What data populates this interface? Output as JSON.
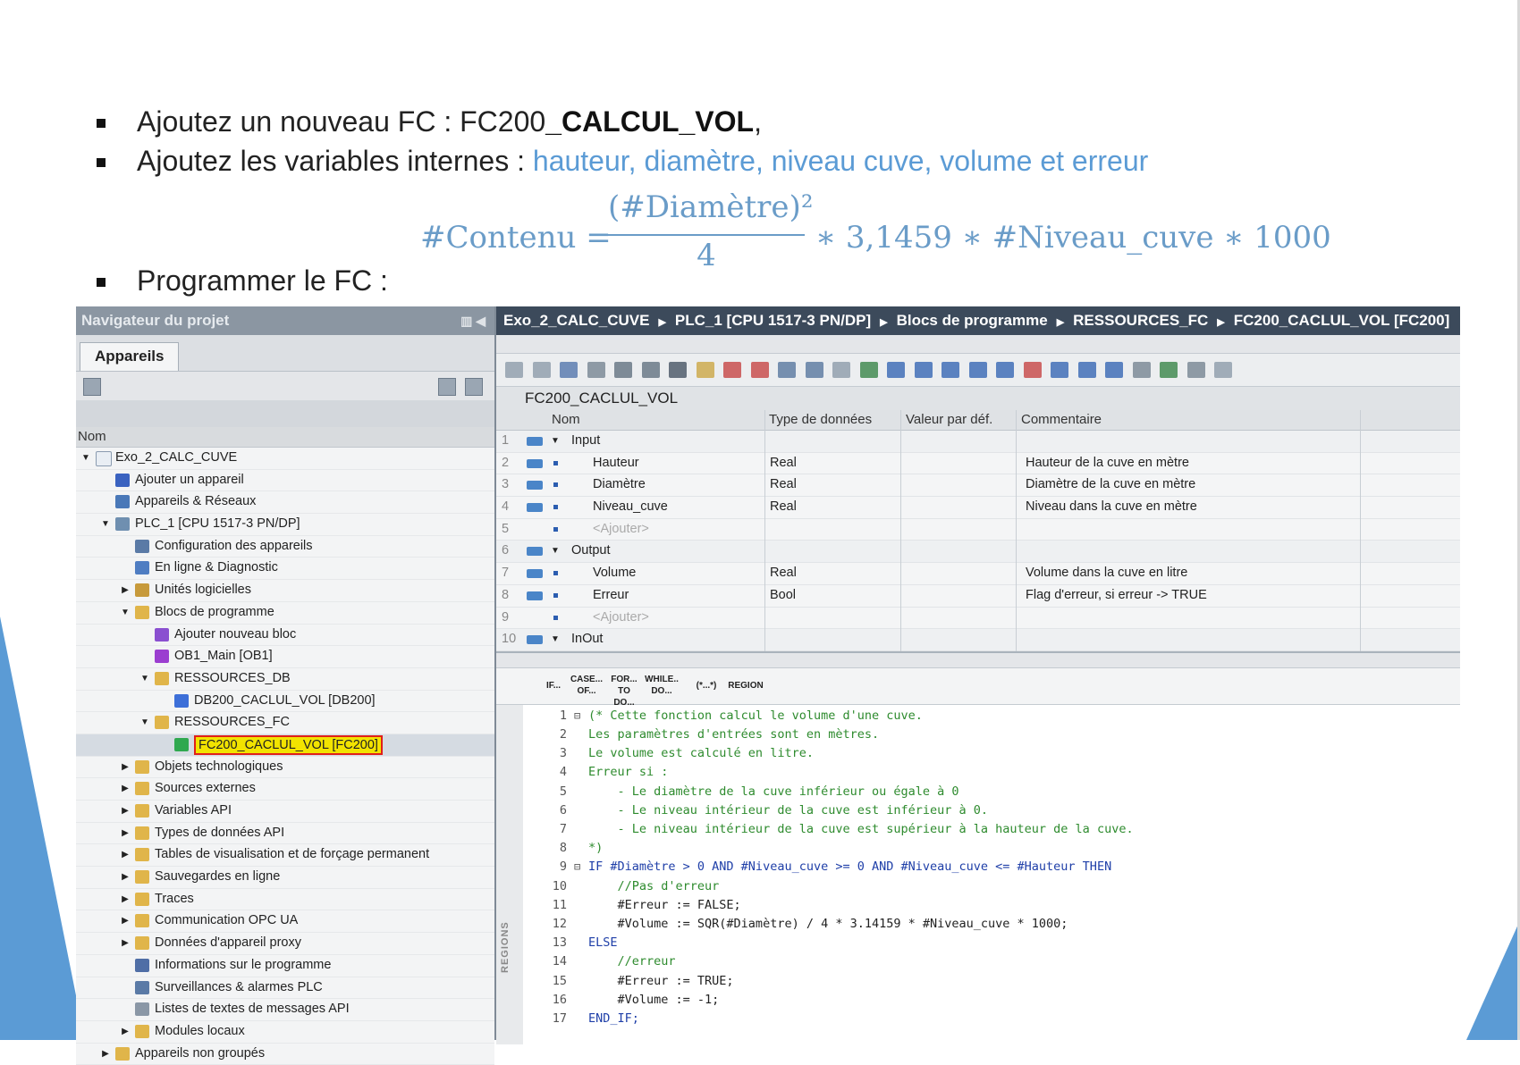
{
  "slide": {
    "bullet1_prefix": "Ajoutez un nouveau FC : FC200",
    "bullet1_bold": "_CALCUL_VOL",
    "bullet1_suffix": ",",
    "bullet2_prefix": "Ajoutez les variables internes : ",
    "bullet2_blue": "hauteur, diamètre, niveau cuve, volume et erreur",
    "bullet3": "Programmer le FC :",
    "formula": {
      "lhs": "#Contenu =",
      "numerator": "(#Diamètre)²",
      "denominator": "4",
      "rhs": "∗ 3,1459 ∗ #Niveau_cuve  ∗ 1000"
    }
  },
  "navigator": {
    "title": "Navigateur du projet",
    "tab": "Appareils",
    "column_header": "Nom",
    "tree": [
      {
        "label": "Exo_2_CALC_CUVE",
        "level": 0,
        "arrow": "open",
        "icon": "project-icon"
      },
      {
        "label": "Ajouter un appareil",
        "level": 1,
        "arrow": "none",
        "icon": "add-device-icon"
      },
      {
        "label": "Appareils & Réseaux",
        "level": 1,
        "arrow": "none",
        "icon": "network-icon"
      },
      {
        "label": "PLC_1 [CPU 1517-3 PN/DP]",
        "level": 1,
        "arrow": "open",
        "icon": "plc-icon"
      },
      {
        "label": "Configuration des appareils",
        "level": 2,
        "arrow": "none",
        "icon": "device-config-icon"
      },
      {
        "label": "En ligne & Diagnostic",
        "level": 2,
        "arrow": "none",
        "icon": "diagnostic-icon"
      },
      {
        "label": "Unités logicielles",
        "level": 2,
        "arrow": "closed",
        "icon": "software-units-icon"
      },
      {
        "label": "Blocs de programme",
        "level": 2,
        "arrow": "open",
        "icon": "folder-icon"
      },
      {
        "label": "Ajouter nouveau bloc",
        "level": 3,
        "arrow": "none",
        "icon": "add-block-icon"
      },
      {
        "label": "OB1_Main [OB1]",
        "level": 3,
        "arrow": "none",
        "icon": "ob-block-icon"
      },
      {
        "label": "RESSOURCES_DB",
        "level": 3,
        "arrow": "open",
        "icon": "folder-icon"
      },
      {
        "label": "DB200_CACLUL_VOL [DB200]",
        "level": 4,
        "arrow": "none",
        "icon": "db-block-icon"
      },
      {
        "label": "RESSOURCES_FC",
        "level": 3,
        "arrow": "open",
        "icon": "folder-icon"
      },
      {
        "label": "FC200_CACLUL_VOL [FC200]",
        "level": 4,
        "arrow": "none",
        "icon": "fc-block-icon",
        "selected": true
      },
      {
        "label": "Objets technologiques",
        "level": 2,
        "arrow": "closed",
        "icon": "folder-icon"
      },
      {
        "label": "Sources externes",
        "level": 2,
        "arrow": "closed",
        "icon": "folder-icon"
      },
      {
        "label": "Variables API",
        "level": 2,
        "arrow": "closed",
        "icon": "folder-icon"
      },
      {
        "label": "Types de données API",
        "level": 2,
        "arrow": "closed",
        "icon": "folder-icon"
      },
      {
        "label": "Tables de visualisation et de forçage permanent",
        "level": 2,
        "arrow": "closed",
        "icon": "folder-icon"
      },
      {
        "label": "Sauvegardes en ligne",
        "level": 2,
        "arrow": "closed",
        "icon": "folder-icon"
      },
      {
        "label": "Traces",
        "level": 2,
        "arrow": "closed",
        "icon": "folder-icon"
      },
      {
        "label": "Communication OPC UA",
        "level": 2,
        "arrow": "closed",
        "icon": "folder-icon"
      },
      {
        "label": "Données d'appareil proxy",
        "level": 2,
        "arrow": "closed",
        "icon": "folder-icon"
      },
      {
        "label": "Informations sur le programme",
        "level": 2,
        "arrow": "none",
        "icon": "info-icon"
      },
      {
        "label": "Surveillances & alarmes PLC",
        "level": 2,
        "arrow": "none",
        "icon": "alarm-icon"
      },
      {
        "label": "Listes de textes de messages API",
        "level": 2,
        "arrow": "none",
        "icon": "text-list-icon"
      },
      {
        "label": "Modules locaux",
        "level": 2,
        "arrow": "closed",
        "icon": "folder-icon"
      },
      {
        "label": "Appareils non groupés",
        "level": 1,
        "arrow": "closed",
        "icon": "folder-icon"
      }
    ]
  },
  "editor": {
    "breadcrumb": [
      "Exo_2_CALC_CUVE",
      "PLC_1 [CPU 1517-3 PN/DP]",
      "Blocs de programme",
      "RESSOURCES_FC",
      "FC200_CACLUL_VOL [FC200]"
    ],
    "block_name": "FC200_CACLUL_VOL",
    "interface_headers": {
      "nom": "Nom",
      "type": "Type de données",
      "default": "Valeur par déf.",
      "comment": "Commentaire"
    },
    "interface_rows": [
      {
        "num": "1",
        "kind": "section",
        "name": "Input",
        "type": "",
        "comment": ""
      },
      {
        "num": "2",
        "kind": "var",
        "name": "Hauteur",
        "type": "Real",
        "comment": "Hauteur de la cuve en mètre"
      },
      {
        "num": "3",
        "kind": "var",
        "name": "Diamètre",
        "type": "Real",
        "comment": "Diamètre de la cuve en mètre"
      },
      {
        "num": "4",
        "kind": "var",
        "name": "Niveau_cuve",
        "type": "Real",
        "comment": "Niveau dans la cuve en mètre"
      },
      {
        "num": "5",
        "kind": "add",
        "name": "<Ajouter>",
        "type": "",
        "comment": ""
      },
      {
        "num": "6",
        "kind": "section",
        "name": "Output",
        "type": "",
        "comment": ""
      },
      {
        "num": "7",
        "kind": "var",
        "name": "Volume",
        "type": "Real",
        "comment": "Volume dans la cuve en litre"
      },
      {
        "num": "8",
        "kind": "var",
        "name": "Erreur",
        "type": "Bool",
        "comment": "Flag d'erreur, si erreur -> TRUE"
      },
      {
        "num": "9",
        "kind": "add",
        "name": "<Ajouter>",
        "type": "",
        "comment": ""
      },
      {
        "num": "10",
        "kind": "section",
        "name": "InOut",
        "type": "",
        "comment": ""
      }
    ],
    "code_templates": [
      "IF...",
      "CASE... OF...",
      "FOR... TO DO...",
      "WHILE.. DO...",
      "(*...*)",
      "REGION"
    ],
    "regions_label": "REGIONS",
    "code_lines": [
      {
        "n": "1",
        "fold": "⊟",
        "text": "(* Cette fonction calcul le volume d'une cuve.",
        "cls": "cm"
      },
      {
        "n": "2",
        "fold": "",
        "text": "Les paramètres d'entrées sont en mètres.",
        "cls": "cm"
      },
      {
        "n": "3",
        "fold": "",
        "text": "Le volume est calculé en litre.",
        "cls": "cm"
      },
      {
        "n": "4",
        "fold": "",
        "text": "Erreur si :",
        "cls": "cm"
      },
      {
        "n": "5",
        "fold": "",
        "text": "    - Le diamètre de la cuve inférieur ou égale à 0",
        "cls": "cm"
      },
      {
        "n": "6",
        "fold": "",
        "text": "    - Le niveau intérieur de la cuve est inférieur à 0.",
        "cls": "cm"
      },
      {
        "n": "7",
        "fold": "",
        "text": "    - Le niveau intérieur de la cuve est supérieur à la hauteur de la cuve.",
        "cls": "cm"
      },
      {
        "n": "8",
        "fold": "",
        "text": "*)",
        "cls": "cm"
      },
      {
        "n": "9",
        "fold": "⊟",
        "text": "IF #Diamètre > 0 AND #Niveau_cuve >= 0 AND #Niveau_cuve <= #Hauteur THEN",
        "cls": "kw"
      },
      {
        "n": "10",
        "fold": "",
        "text": "    //Pas d'erreur",
        "cls": "cm"
      },
      {
        "n": "11",
        "fold": "",
        "text": "    #Erreur := FALSE;",
        "cls": "var"
      },
      {
        "n": "12",
        "fold": "",
        "text": "    #Volume := SQR(#Diamètre) / 4 * 3.14159 * #Niveau_cuve * 1000;",
        "cls": "var"
      },
      {
        "n": "13",
        "fold": "",
        "text": "ELSE",
        "cls": "kw"
      },
      {
        "n": "14",
        "fold": "",
        "text": "    //erreur",
        "cls": "cm"
      },
      {
        "n": "15",
        "fold": "",
        "text": "    #Erreur := TRUE;",
        "cls": "var"
      },
      {
        "n": "16",
        "fold": "",
        "text": "    #Volume := -1;",
        "cls": "var"
      },
      {
        "n": "17",
        "fold": "",
        "text": "END_IF;",
        "cls": "kw"
      }
    ]
  },
  "colors": {
    "accent_blue": "#5b9bd5",
    "breadcrumb_bg": "#3c4a5b",
    "nav_title_bg": "#8b96a2",
    "selection_highlight": "#f2e300",
    "selection_border": "#e0201a",
    "comment_green": "#2e8b2e",
    "keyword_blue": "#1f3fa8"
  }
}
